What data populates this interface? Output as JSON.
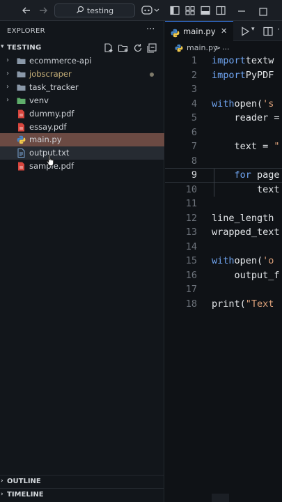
{
  "titlebar": {
    "search_text": "testing",
    "icons": [
      "arrow-left-icon",
      "arrow-right-icon",
      "search-icon",
      "copilot-icon",
      "layout-icons",
      "minimize-icon",
      "maximize-icon"
    ]
  },
  "sidebar": {
    "header": "EXPLORER",
    "more": "···",
    "folder": "TESTING",
    "items": [
      {
        "label": "ecommerce-api",
        "type": "folder"
      },
      {
        "label": "jobscraper",
        "type": "folder",
        "modified": true
      },
      {
        "label": "task_tracker",
        "type": "folder"
      },
      {
        "label": "venv",
        "type": "folder-env"
      },
      {
        "label": "dummy.pdf",
        "type": "pdf"
      },
      {
        "label": "essay.pdf",
        "type": "pdf"
      },
      {
        "label": "main.py",
        "type": "python",
        "selected": true
      },
      {
        "label": "output.txt",
        "type": "text",
        "hover": true
      },
      {
        "label": "sample.pdf",
        "type": "pdf"
      }
    ],
    "outline": "OUTLINE",
    "timeline": "TIMELINE"
  },
  "editor": {
    "tab_label": "main.py",
    "breadcrumb_file": "main.py",
    "breadcrumb_sep": ">",
    "breadcrumb_symbol": "...",
    "active_line": 9,
    "lines": [
      {
        "n": "1",
        "tokens": [
          [
            "kw",
            "import"
          ],
          [
            "",
            "textw"
          ]
        ]
      },
      {
        "n": "2",
        "tokens": [
          [
            "kw",
            "import"
          ],
          [
            "",
            "PyPDF"
          ]
        ]
      },
      {
        "n": "3",
        "tokens": []
      },
      {
        "n": "4",
        "tokens": [
          [
            "kw",
            "with"
          ],
          [
            "",
            "open("
          ],
          [
            "str",
            "'s"
          ]
        ]
      },
      {
        "n": "5",
        "tokens": [
          [
            "",
            "    reader ="
          ]
        ]
      },
      {
        "n": "6",
        "tokens": []
      },
      {
        "n": "7",
        "tokens": [
          [
            "",
            "    text = "
          ],
          [
            "str",
            "\""
          ]
        ]
      },
      {
        "n": "8",
        "tokens": []
      },
      {
        "n": "9",
        "tokens": [
          [
            "",
            "    "
          ],
          [
            "kw",
            "for"
          ],
          [
            "",
            " page"
          ]
        ]
      },
      {
        "n": "10",
        "tokens": [
          [
            "",
            "        text"
          ]
        ]
      },
      {
        "n": "11",
        "tokens": []
      },
      {
        "n": "12",
        "tokens": [
          [
            "",
            "line_length"
          ]
        ]
      },
      {
        "n": "13",
        "tokens": [
          [
            "",
            "wrapped_text"
          ]
        ]
      },
      {
        "n": "14",
        "tokens": []
      },
      {
        "n": "15",
        "tokens": [
          [
            "kw",
            "with"
          ],
          [
            "",
            "open("
          ],
          [
            "str",
            "'o"
          ]
        ]
      },
      {
        "n": "16",
        "tokens": [
          [
            "",
            "    output_f"
          ]
        ]
      },
      {
        "n": "17",
        "tokens": []
      },
      {
        "n": "18",
        "tokens": [
          [
            "",
            "print("
          ],
          [
            "str",
            "\"Text"
          ]
        ]
      }
    ]
  }
}
